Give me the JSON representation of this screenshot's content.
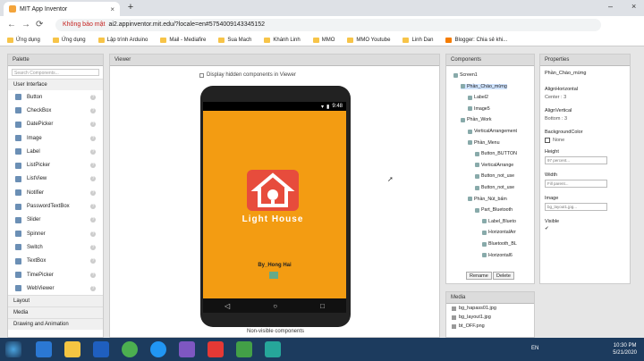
{
  "browser": {
    "tab_title": "MIT App Inventor",
    "tab_close": "×",
    "new_tab": "+",
    "security_label": "Không bảo mật",
    "url": "ai2.appinventor.mit.edu/?locale=en#5754009143345152",
    "bookmarks": [
      "Ứng dụng",
      "Ứng dụng",
      "Lập trình Arduino",
      "Mail - Mediafire",
      "Sua Mach",
      "Khánh Linh",
      "MMO",
      "MMO Youtube",
      "Linh Dan",
      "Blogger: Chia sẻ khi..."
    ],
    "back": "←",
    "forward": "→",
    "reload": "⟳",
    "minimize": "–",
    "close": "×"
  },
  "palette": {
    "title": "Palette",
    "search_placeholder": "Search Components...",
    "category_ui": "User Interface",
    "items": [
      "Button",
      "CheckBox",
      "DatePicker",
      "Image",
      "Label",
      "ListPicker",
      "ListView",
      "Notifier",
      "PasswordTextBox",
      "Slider",
      "Spinner",
      "Switch",
      "TextBox",
      "TimePicker",
      "WebViewer"
    ],
    "categories": [
      "Layout",
      "Media",
      "Drawing and Animation"
    ]
  },
  "viewer": {
    "title": "Viewer",
    "hidden_label": "Display hidden components in Viewer",
    "time": "9:48",
    "logo_text": "Light House",
    "byline": "By_Hong Hai",
    "non_visible": "Non-visible components",
    "nav_back": "◁",
    "nav_home": "○",
    "nav_recent": "□"
  },
  "components": {
    "title": "Components",
    "tree": [
      "Screen1",
      "Phần_Chào_mừng",
      "Label2",
      "Image5",
      "Phần_Work",
      "VerticalArrangement",
      "Phần_Menu",
      "Button_BUTTON",
      "VerticalArrange",
      "Button_not_use",
      "Button_not_use",
      "Phần_Nút_bấm",
      "Part_Bluetooth",
      "Label_Blueto",
      "HorizontalArr",
      "Bluetooth_BL",
      "Horizontal6"
    ],
    "rename": "Rename",
    "delete": "Delete"
  },
  "media": {
    "title": "Media",
    "files": [
      "bg_hapass01.jpg",
      "bg_layout1.jpg",
      "bt_OFF.png"
    ]
  },
  "properties": {
    "title": "Properties",
    "selected": "Phần_Chào_mừng",
    "align_h_label": "AlignHorizontal",
    "align_h_value": "Center : 3",
    "align_v_label": "AlignVertical",
    "align_v_value": "Bottom : 3",
    "bgcolor_label": "BackgroundColor",
    "bgcolor_value": "None",
    "height_label": "Height",
    "height_value": "97 percent...",
    "width_label": "Width",
    "width_value": "Fill parent...",
    "image_label": "Image",
    "image_value": "bg_layout1.jpg...",
    "visible_label": "Visible",
    "visible_value": "✔"
  },
  "taskbar": {
    "lang": "EN",
    "time": "10:30 PM",
    "date": "5/21/2020"
  },
  "colors": {
    "accent": "#f39c12",
    "logo": "#e74c3c",
    "taskbar": "#1c3b5e"
  }
}
